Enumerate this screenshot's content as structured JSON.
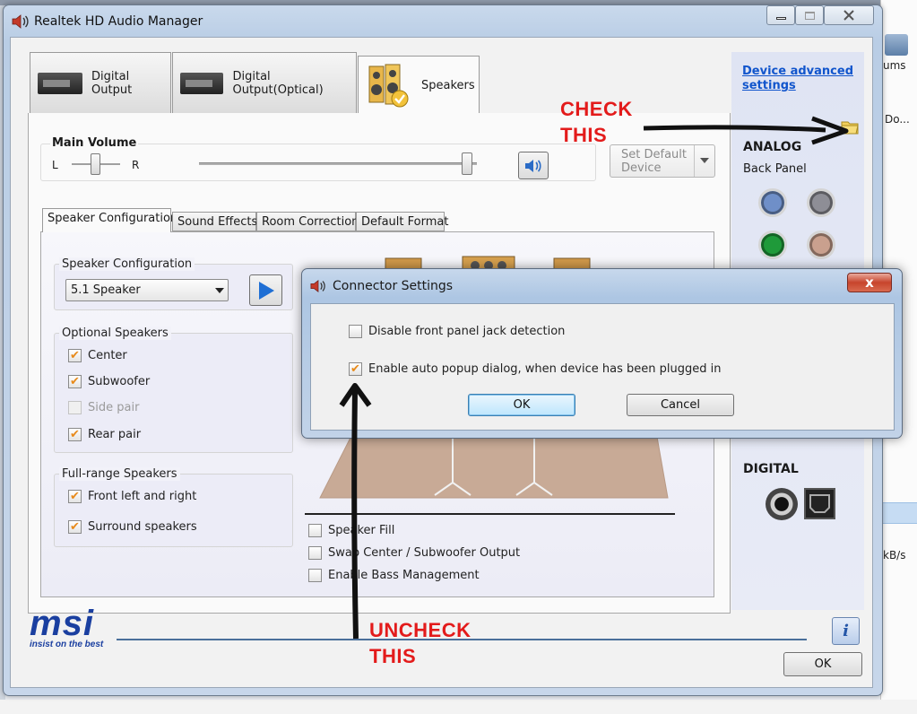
{
  "window": {
    "title": "Realtek HD Audio Manager",
    "ok_label": "OK"
  },
  "background_app": {
    "partial_texts": [
      "ums",
      "Do...",
      "kB/s"
    ]
  },
  "device_tabs": [
    {
      "label": "Digital Output",
      "icon": "audio-device-icon"
    },
    {
      "label": "Digital Output(Optical)",
      "icon": "audio-device-icon"
    },
    {
      "label": "Speakers",
      "icon": "speakers-icon",
      "active": true
    }
  ],
  "main_volume": {
    "label": "Main Volume",
    "left_label": "L",
    "right_label": "R"
  },
  "set_default_device": {
    "label_line1": "Set Default",
    "label_line2": "Device"
  },
  "sub_tabs": [
    {
      "label": "Speaker Configuration",
      "active": true
    },
    {
      "label": "Sound Effects"
    },
    {
      "label": "Room Correction"
    },
    {
      "label": "Default Format"
    }
  ],
  "speaker_configuration": {
    "group_label": "Speaker Configuration",
    "selected": "5.1 Speaker"
  },
  "optional_speakers": {
    "group_label": "Optional Speakers",
    "items": [
      {
        "label": "Center",
        "checked": true,
        "enabled": true
      },
      {
        "label": "Subwoofer",
        "checked": true,
        "enabled": true
      },
      {
        "label": "Side pair",
        "checked": false,
        "enabled": false
      },
      {
        "label": "Rear pair",
        "checked": true,
        "enabled": true
      }
    ]
  },
  "full_range_speakers": {
    "group_label": "Full-range Speakers",
    "items": [
      {
        "label": "Front left and right",
        "checked": true
      },
      {
        "label": "Surround speakers",
        "checked": true
      }
    ]
  },
  "bottom_options": [
    {
      "label": "Speaker Fill",
      "checked": false
    },
    {
      "label": "Swap Center / Subwoofer Output",
      "checked": false
    },
    {
      "label": "Enable Bass Management",
      "checked": false
    }
  ],
  "right_panel": {
    "advanced_link_line1": "Device advanced",
    "advanced_link_line2": "settings",
    "analog_heading": "ANALOG",
    "back_panel_label": "Back Panel",
    "digital_heading": "DIGITAL",
    "jack_colors": [
      "#6f8fc8",
      "#8e8e96",
      "#1f9a3a",
      "#c9a08e",
      "#b8bfdc",
      "#b8bfdc"
    ]
  },
  "dialog": {
    "title": "Connector Settings",
    "close_label": "x",
    "options": [
      {
        "label": "Disable front panel jack detection",
        "checked": false
      },
      {
        "label": "Enable auto popup dialog, when device has been plugged in",
        "checked": true
      }
    ],
    "ok_label": "OK",
    "cancel_label": "Cancel"
  },
  "annotations": {
    "check_line1": "CHECK",
    "check_line2": "THIS",
    "uncheck_line1": "UNCHECK",
    "uncheck_line2": "THIS"
  },
  "brand": {
    "logo_text": "msi",
    "tagline": "insist on the best"
  },
  "info_button_label": "i",
  "check_mark": "✔"
}
